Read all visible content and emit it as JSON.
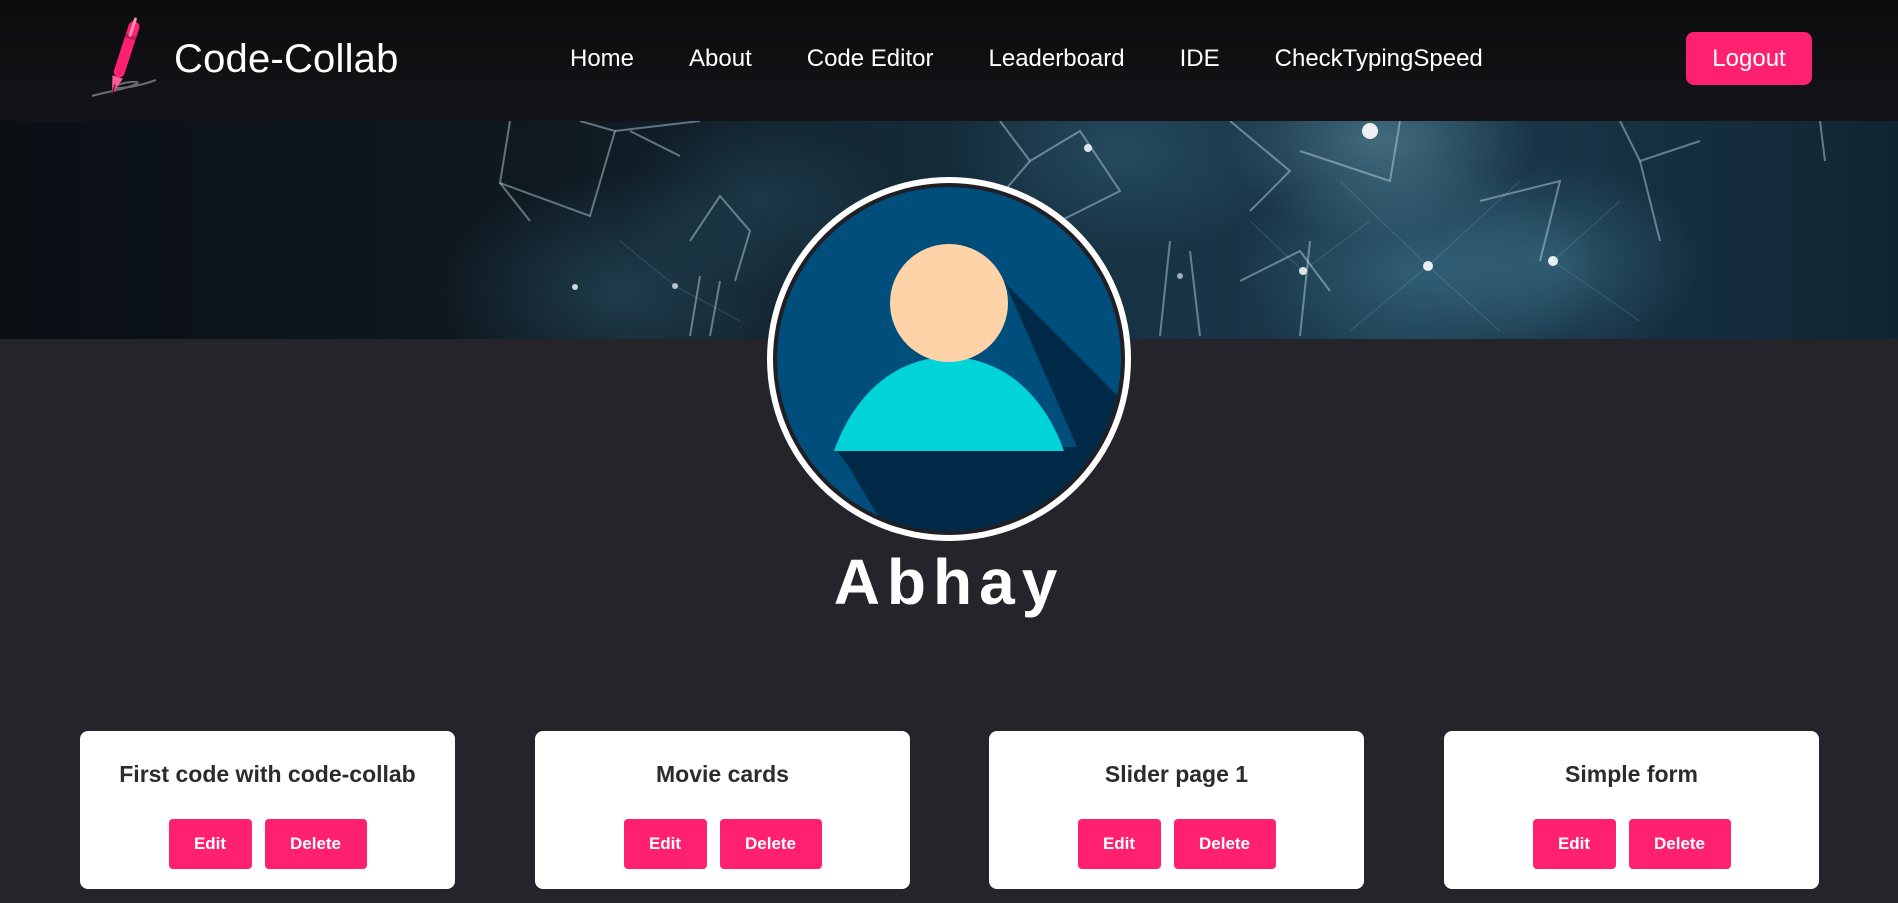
{
  "navbar": {
    "brand_name": "Code-Collab",
    "links": [
      "Home",
      "About",
      "Code Editor",
      "Leaderboard",
      "IDE",
      "CheckTypingSpeed"
    ],
    "logout_label": "Logout"
  },
  "profile": {
    "username": "Abhay"
  },
  "cards": [
    {
      "title": "First code with code-collab",
      "edit_label": "Edit",
      "delete_label": "Delete"
    },
    {
      "title": "Movie cards",
      "edit_label": "Edit",
      "delete_label": "Delete"
    },
    {
      "title": "Slider page 1",
      "edit_label": "Edit",
      "delete_label": "Delete"
    },
    {
      "title": "Simple form",
      "edit_label": "Edit",
      "delete_label": "Delete"
    }
  ],
  "colors": {
    "accent": "#ff2170",
    "background": "#25242b",
    "navbar": "#0c0c0f",
    "card": "#ffffff"
  },
  "icons": {
    "brand_logo": "pen-signature-icon",
    "avatar": "user-avatar-icon"
  }
}
